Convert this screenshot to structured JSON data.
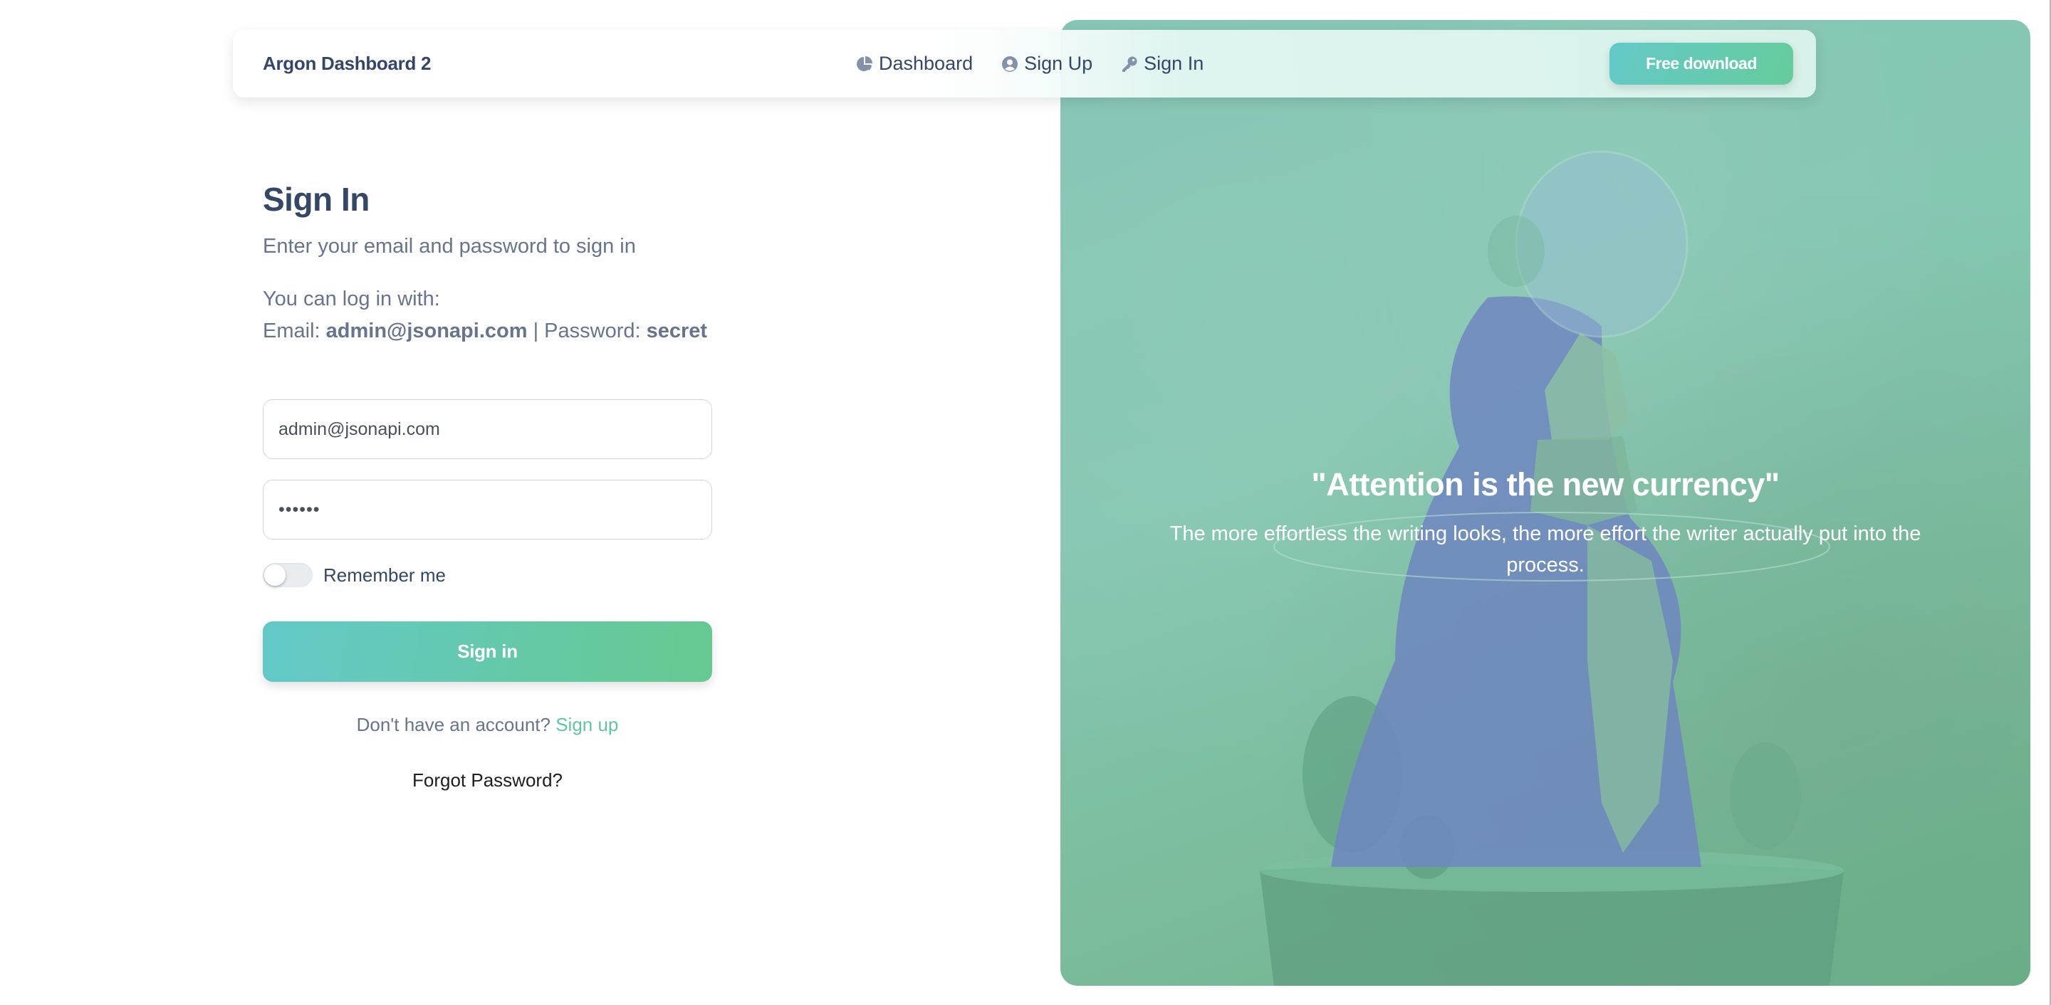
{
  "navbar": {
    "brand": "Argon Dashboard 2",
    "links": [
      {
        "label": "Dashboard",
        "icon": "pie-chart-icon"
      },
      {
        "label": "Sign Up",
        "icon": "user-circle-icon"
      },
      {
        "label": "Sign In",
        "icon": "key-icon"
      }
    ],
    "cta_label": "Free download"
  },
  "form": {
    "title": "Sign In",
    "subtitle": "Enter your email and password to sign in",
    "hint_line1": "You can log in with:",
    "hint_email_label": "Email: ",
    "hint_email_value": "admin@jsonapi.com",
    "hint_separator": " | Password: ",
    "hint_password_value": "secret",
    "email_value": "admin@jsonapi.com",
    "password_value": "••••••",
    "remember_label": "Remember me",
    "remember_checked": false,
    "submit_label": "Sign in",
    "no_account_text": "Don't have an account? ",
    "signup_link": "Sign up",
    "forgot_label": "Forgot Password?"
  },
  "hero": {
    "quote_title": "\"Attention is the new currency\"",
    "quote_body": "The more effortless the writing looks, the more effort the writer actually put into the process."
  },
  "colors": {
    "accent_start": "#63c9c8",
    "accent_end": "#66cc9c",
    "text_dark": "#344767",
    "text_muted": "#67748e",
    "link": "#5fc5a4"
  }
}
